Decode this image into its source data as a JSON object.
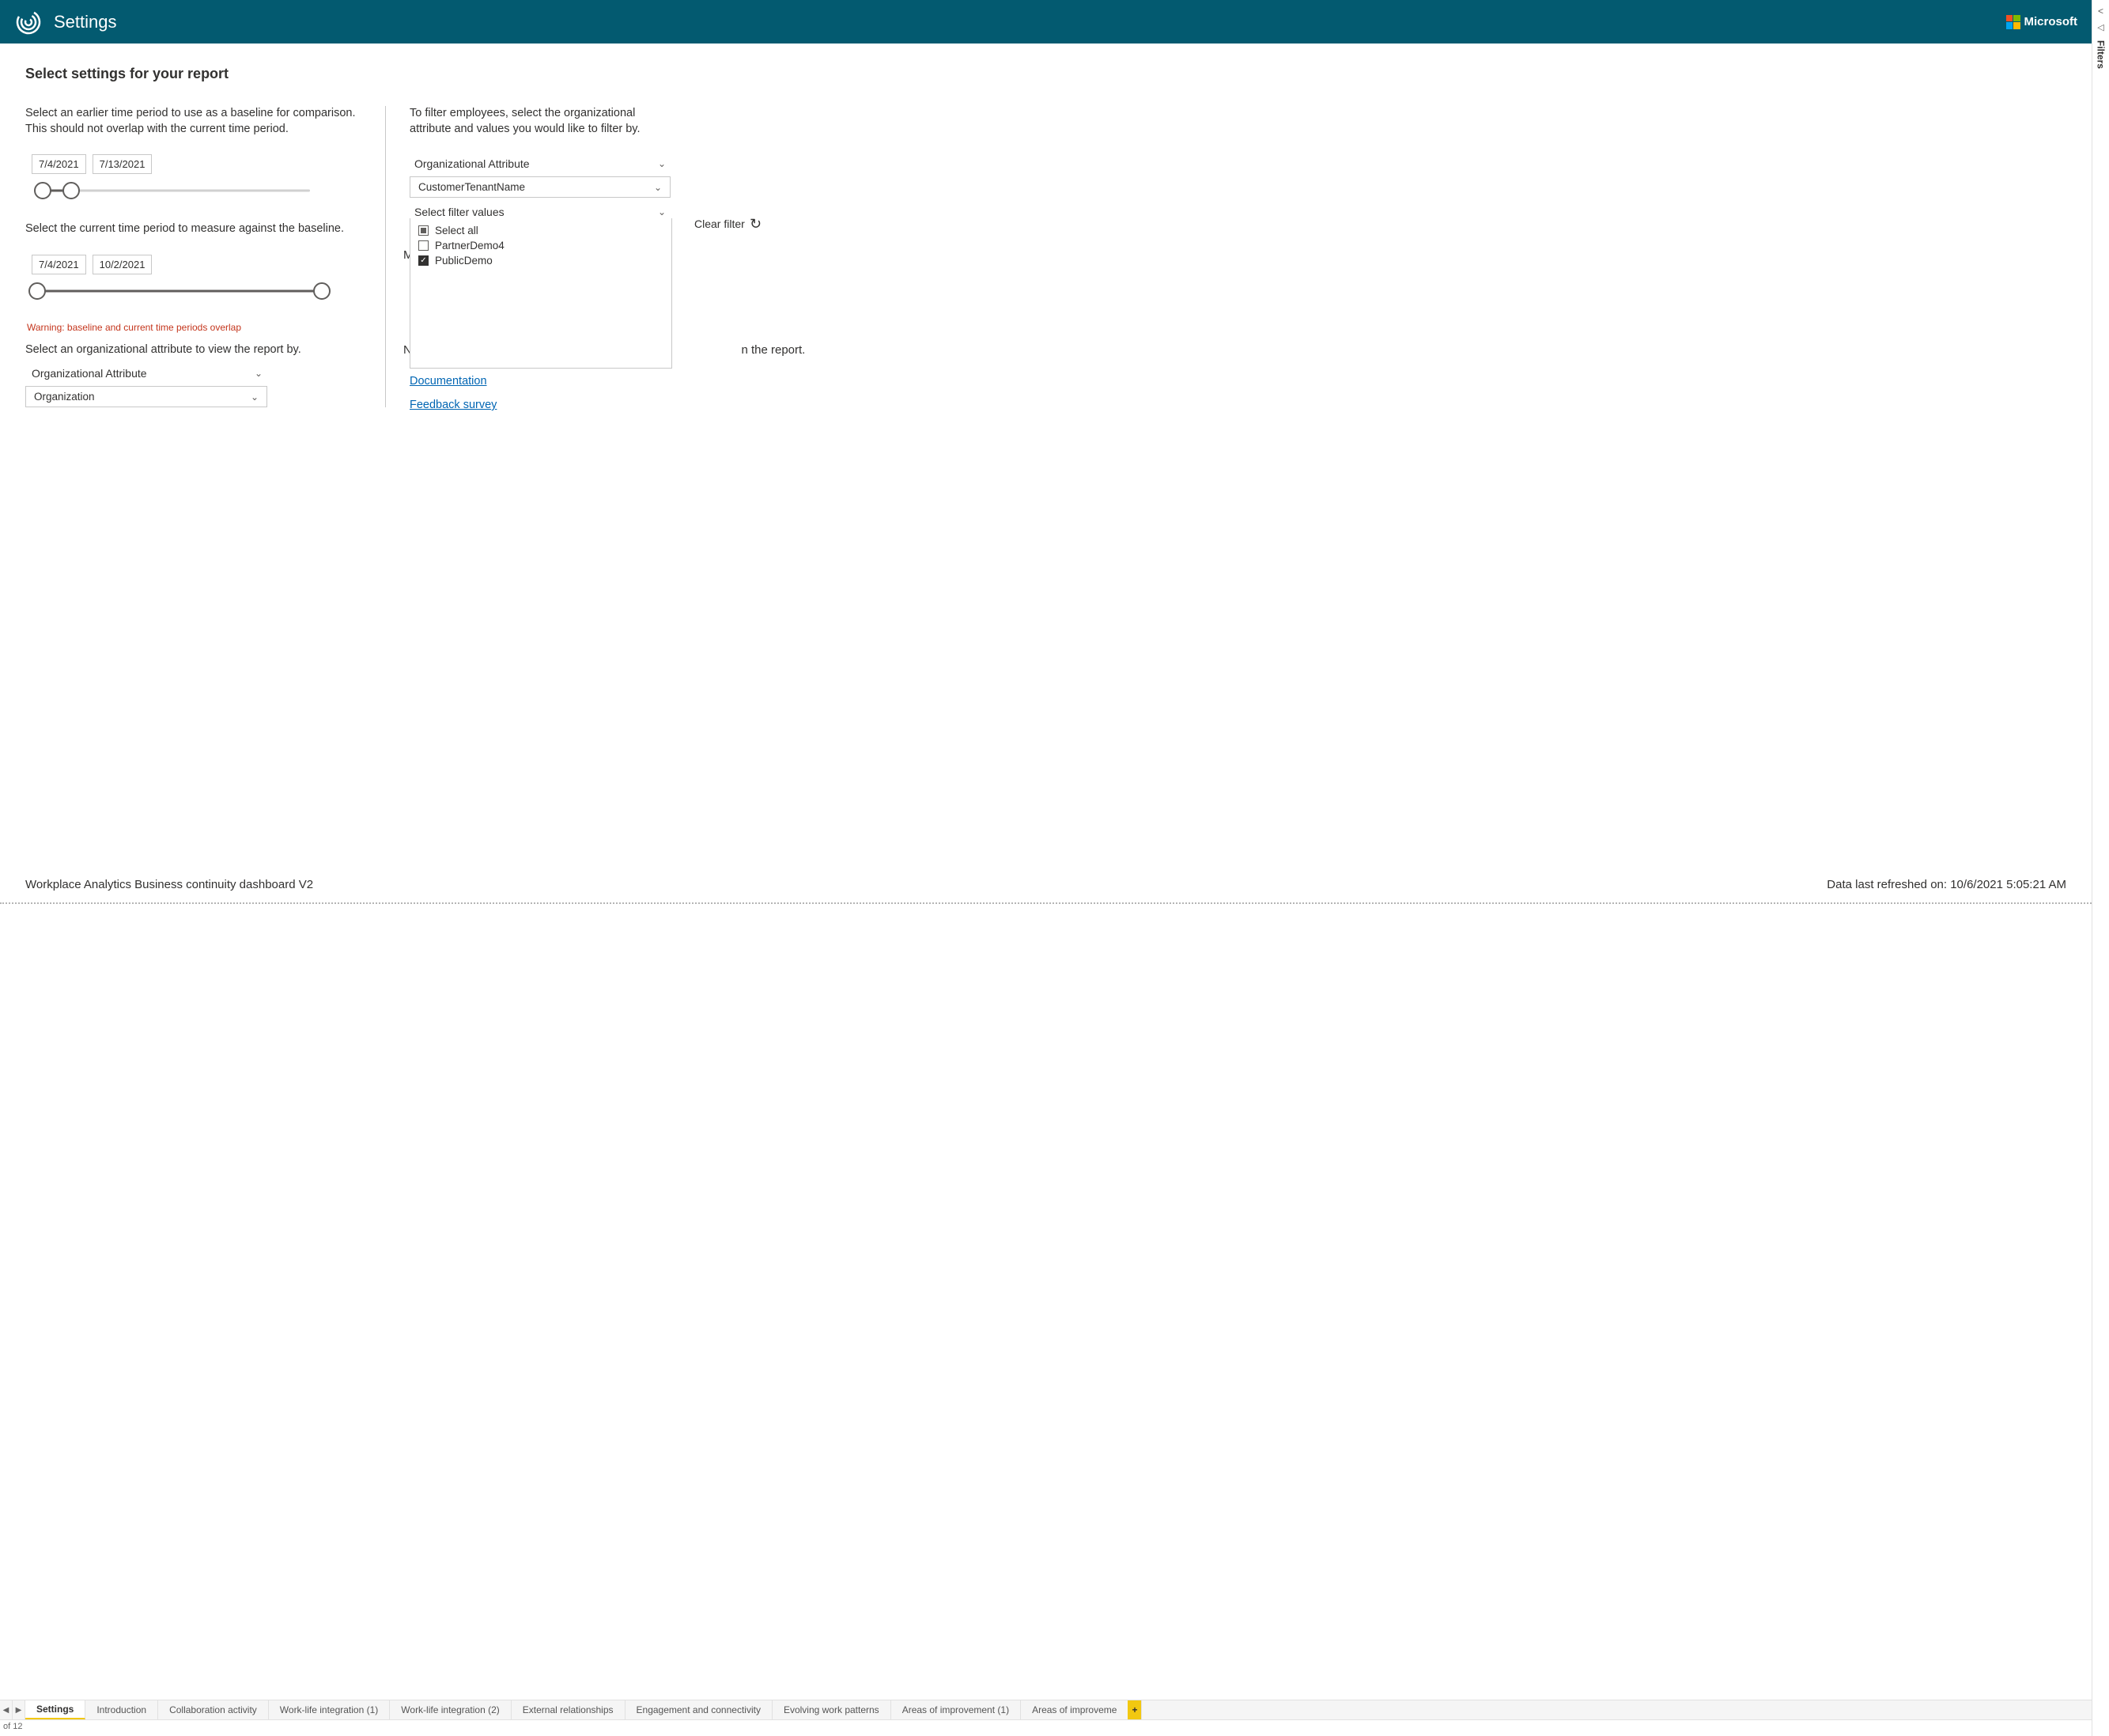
{
  "header": {
    "title": "Settings",
    "brand": "Microsoft"
  },
  "filtersRail": {
    "label": "Filters"
  },
  "sectionTitle": "Select settings for your report",
  "left": {
    "baselineIntro": "Select an earlier time period to use as a baseline for comparison. This should not overlap with the current time period.",
    "baselineStart": "7/4/2021",
    "baselineEnd": "7/13/2021",
    "currentIntro": "Select the current time period to measure against the baseline.",
    "currentStart": "7/4/2021",
    "currentEnd": "10/2/2021",
    "warning": "Warning: baseline and current time periods overlap",
    "orgAttrIntro": "Select an organizational attribute to view the report by.",
    "orgAttrLabel": "Organizational Attribute",
    "orgAttrValue": "Organization"
  },
  "right": {
    "filterIntro": "To filter employees, select the organizational attribute and values you would like to filter by.",
    "orgAttrLabel": "Organizational Attribute",
    "orgAttrValue": "CustomerTenantName",
    "selectFilterLabel": "Select filter values",
    "selectedValue": "PublicDemo",
    "options": {
      "selectAll": "Select all",
      "opt1": "PartnerDemo4",
      "opt2": "PublicDemo"
    },
    "clearFilter": "Clear filter",
    "behindNoteSuffix": "n the report.",
    "links": {
      "doc": "Documentation",
      "feedback": "Feedback survey"
    },
    "behindM": "M",
    "behindN": "N"
  },
  "footer": {
    "dashName": "Workplace Analytics Business continuity dashboard V2",
    "refresh": "Data last refreshed on: 10/6/2021 5:05:21 AM"
  },
  "tabs": {
    "t0": "Settings",
    "t1": "Introduction",
    "t2": "Collaboration activity",
    "t3": "Work-life integration (1)",
    "t4": "Work-life integration (2)",
    "t5": "External relationships",
    "t6": "Engagement and connectivity",
    "t7": "Evolving work patterns",
    "t8": "Areas of improvement (1)",
    "t9": "Areas of improveme"
  },
  "pageCount": "of 12"
}
